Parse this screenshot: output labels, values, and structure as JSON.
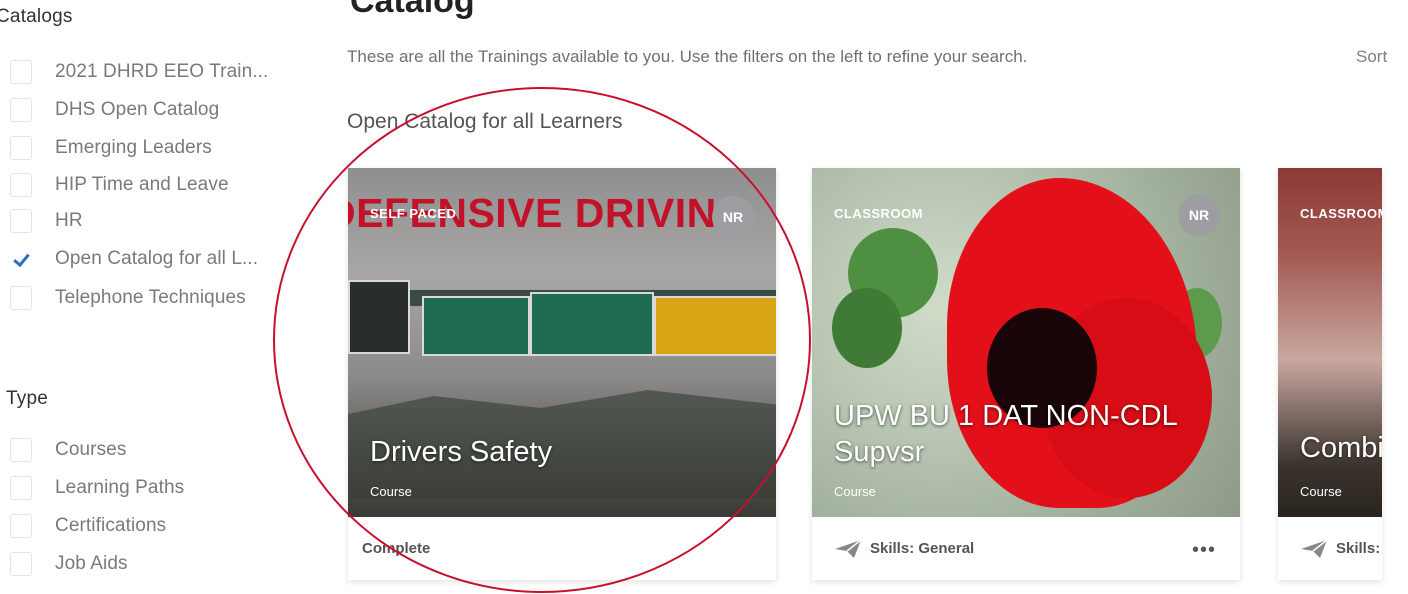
{
  "sidebar": {
    "catalogs_title": "Catalogs",
    "catalogs": [
      {
        "label": "2021 DHRD EEO Train...",
        "checked": false
      },
      {
        "label": "DHS Open Catalog",
        "checked": false
      },
      {
        "label": "Emerging Leaders",
        "checked": false
      },
      {
        "label": "HIP Time and Leave",
        "checked": false
      },
      {
        "label": "HR",
        "checked": false
      },
      {
        "label": "Open Catalog for all L...",
        "checked": true
      },
      {
        "label": "Telephone Techniques",
        "checked": false
      }
    ],
    "type_title": "Type",
    "types": [
      {
        "label": "Courses",
        "checked": false
      },
      {
        "label": "Learning Paths",
        "checked": false
      },
      {
        "label": "Certifications",
        "checked": false
      },
      {
        "label": "Job Aids",
        "checked": false
      }
    ]
  },
  "header": {
    "title": "Catalog",
    "subtitle": "These are all the Trainings available to you. Use the filters on the left to refine your search.",
    "sort_label": "Sort"
  },
  "section": {
    "heading": "Open Catalog for all Learners"
  },
  "cards": [
    {
      "badge": "SELF PACED",
      "nr": "NR",
      "image_text": "DEFENSIVE DRIVING",
      "title": "Drivers Safety",
      "type": "Course",
      "footer": "Complete"
    },
    {
      "badge": "CLASSROOM",
      "nr": "NR",
      "title_line1": "UPW BU 1 DAT NON-CDL",
      "title_line2": "Supvsr",
      "type": "Course",
      "footer": "Skills: General",
      "more": "•••"
    },
    {
      "badge": "CLASSROOM",
      "title": "Combi",
      "type": "Course",
      "footer": "Skills:"
    }
  ],
  "colors": {
    "accent_check": "#2c6fc4",
    "headline_red": "#c4112a",
    "nr_badge": "#9e9ea2"
  }
}
